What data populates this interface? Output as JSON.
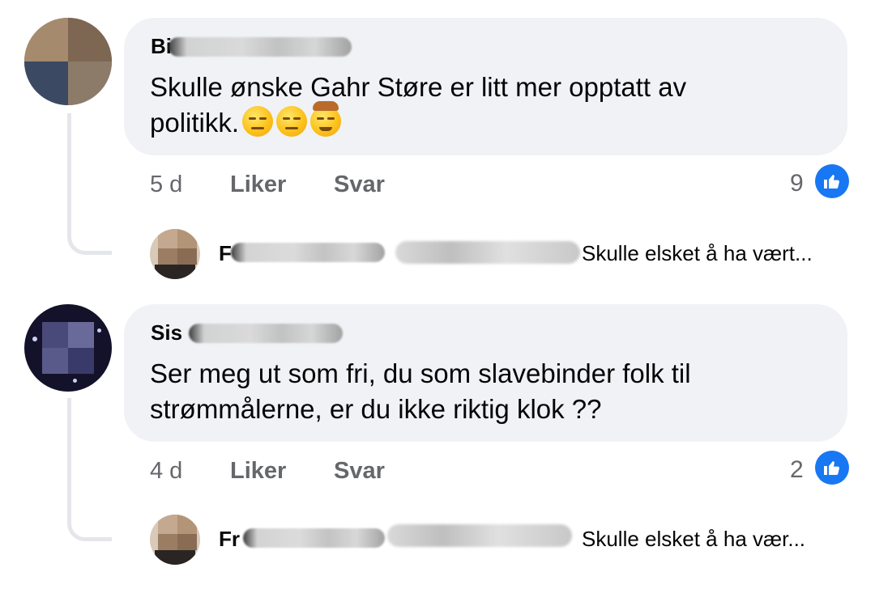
{
  "comments": [
    {
      "author_partial": "Bi",
      "text_line1": "Skulle ønske Gahr Støre er litt mer opptatt av",
      "text_line2": "politikk.",
      "emojis": [
        "unamused-face-icon",
        "unamused-face-icon",
        "cowboy-face-icon"
      ],
      "time": "5 d",
      "like_label": "Liker",
      "reply_label": "Svar",
      "like_count": "9",
      "reply": {
        "author_partial": "F",
        "preview": "Skulle elsket å ha vært..."
      }
    },
    {
      "author_partial": "Sis",
      "text_line1": "Ser meg ut som fri, du som slavebinder folk til",
      "text_line2": "strømmålerne, er du ikke riktig klok ??",
      "time": "4 d",
      "like_label": "Liker",
      "reply_label": "Svar",
      "like_count": "2",
      "reply": {
        "author_partial": "Fr",
        "preview": "Skulle elsket å ha vær..."
      }
    }
  ],
  "colors": {
    "bubble": "#f0f2f5",
    "text": "#050505",
    "muted": "#65676b",
    "like_blue": "#1877f2",
    "thread_line": "#e4e6eb"
  }
}
